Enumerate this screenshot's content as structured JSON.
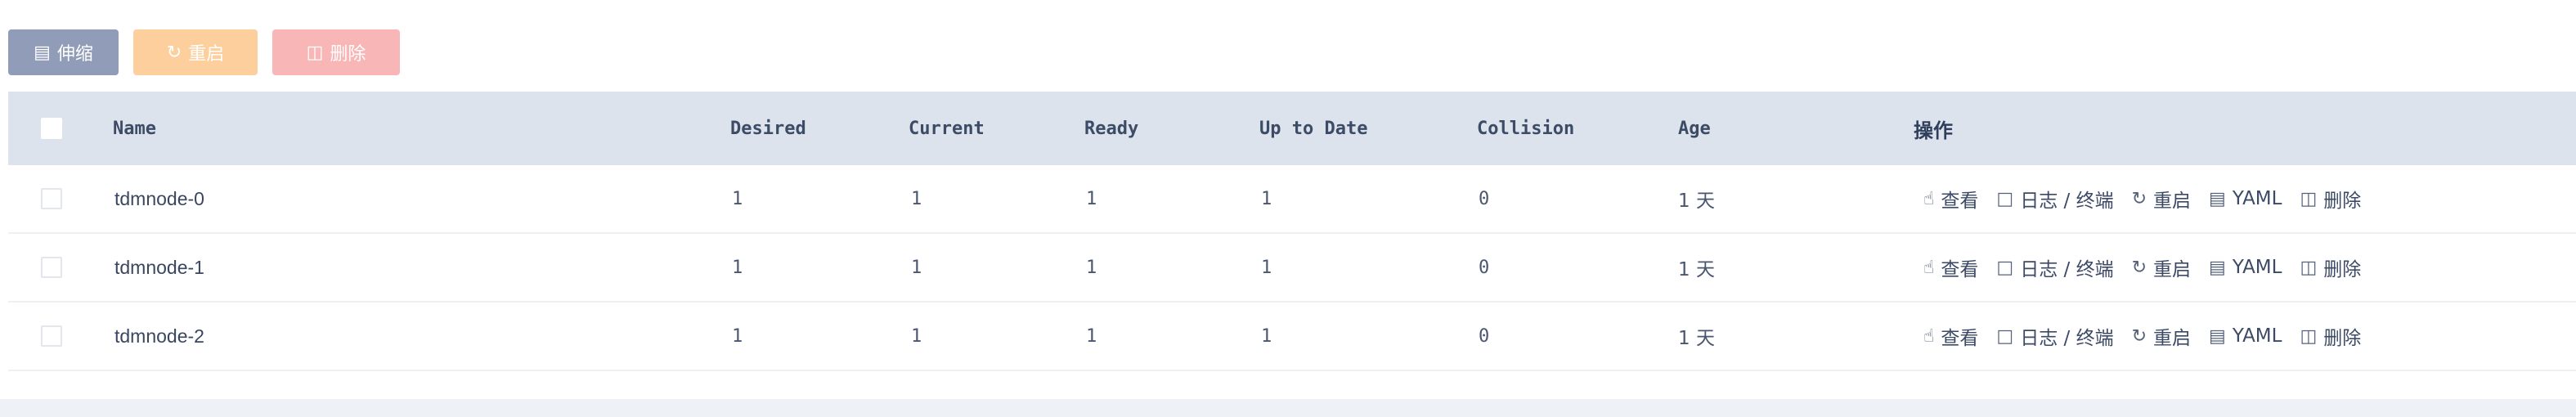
{
  "toolbar": {
    "scale_label": "伸缩",
    "restart_label": "重启",
    "delete_label": "删除"
  },
  "table": {
    "columns": {
      "name": "Name",
      "desired": "Desired",
      "current": "Current",
      "ready": "Ready",
      "up_to_date": "Up to Date",
      "collision": "Collision",
      "age": "Age",
      "actions": "操作"
    },
    "rows": [
      {
        "name": "tdmnode-0",
        "desired": "1",
        "current": "1",
        "ready": "1",
        "up_to_date": "1",
        "collision": "0",
        "age": "1 天"
      },
      {
        "name": "tdmnode-1",
        "desired": "1",
        "current": "1",
        "ready": "1",
        "up_to_date": "1",
        "collision": "0",
        "age": "1 天"
      },
      {
        "name": "tdmnode-2",
        "desired": "1",
        "current": "1",
        "ready": "1",
        "up_to_date": "1",
        "collision": "0",
        "age": "1 天"
      }
    ],
    "row_actions": {
      "view": "查看",
      "logs": "日志 / 终端",
      "restart": "重启",
      "yaml": "YAML",
      "delete": "删除"
    }
  },
  "icons": {
    "scale": "resize-icon",
    "restart": "refresh-icon",
    "delete": "trash-icon",
    "view": "pointer-icon",
    "logs": "terminal-icon",
    "yaml": "document-icon"
  },
  "colors": {
    "scale_button": "#909cb8",
    "restart_button": "#fccf9c",
    "delete_button": "#f8b6b6",
    "header_bg": "#dde3ec"
  }
}
